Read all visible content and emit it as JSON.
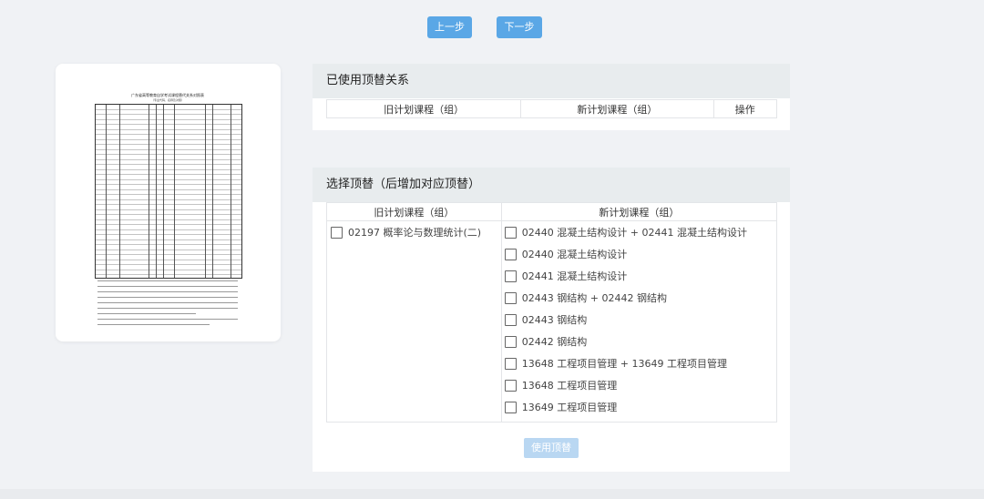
{
  "toolbar": {
    "prev_label": "上一步",
    "next_label": "下一步"
  },
  "preview": {
    "doc_title": "广东省高等教育自学考试课程替代关系对照表",
    "doc_subtitle": "（专业代码、名称及对照）"
  },
  "used_panel": {
    "title": "已使用顶替关系",
    "columns": [
      "旧计划课程（组）",
      "新计划课程（组）",
      "操作"
    ]
  },
  "select_panel": {
    "title": "选择顶替（后增加对应顶替）",
    "columns": [
      "旧计划课程（组）",
      "新计划课程（组）"
    ],
    "old_items": [
      "02197 概率论与数理统计(二)"
    ],
    "new_items": [
      "02440 混凝土结构设计 + 02441 混凝土结构设计",
      "02440 混凝土结构设计",
      "02441 混凝土结构设计",
      "02443 钢结构 + 02442 钢结构",
      "02443 钢结构",
      "02442 钢结构",
      "13648 工程项目管理 + 13649 工程项目管理",
      "13648 工程项目管理",
      "13649 工程项目管理"
    ],
    "apply_label": "使用顶替"
  }
}
